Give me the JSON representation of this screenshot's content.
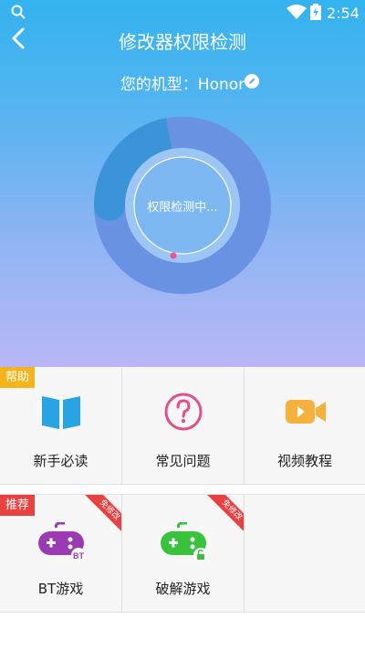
{
  "status_bar": {
    "time": "2:54"
  },
  "header": {
    "title": "修改器权限检测"
  },
  "device": {
    "label": "您的机型：Honor"
  },
  "gauge": {
    "status_text": "权限检测中..."
  },
  "help_section": {
    "tag": "帮助",
    "items": [
      {
        "label": "新手必读",
        "icon": "book-icon"
      },
      {
        "label": "常见问题",
        "icon": "question-icon"
      },
      {
        "label": "视频教程",
        "icon": "video-camera-icon"
      }
    ]
  },
  "recommend_section": {
    "tag": "推荐",
    "items": [
      {
        "label": "BT游戏",
        "icon": "gamepad-bt-icon",
        "badge": "免修改"
      },
      {
        "label": "破解游戏",
        "icon": "gamepad-unlock-icon",
        "badge": "免修改"
      }
    ]
  },
  "colors": {
    "hero_top": "#33b3ef",
    "hero_bottom": "#b9b6f6",
    "help_tag": "#f6b41c",
    "recommend_tag": "#e94040",
    "book_blue": "#27a4e3",
    "question_pink": "#e0508a",
    "video_orange": "#f5b13c",
    "bt_purple": "#9b3bb3",
    "crack_green": "#38c33b"
  }
}
